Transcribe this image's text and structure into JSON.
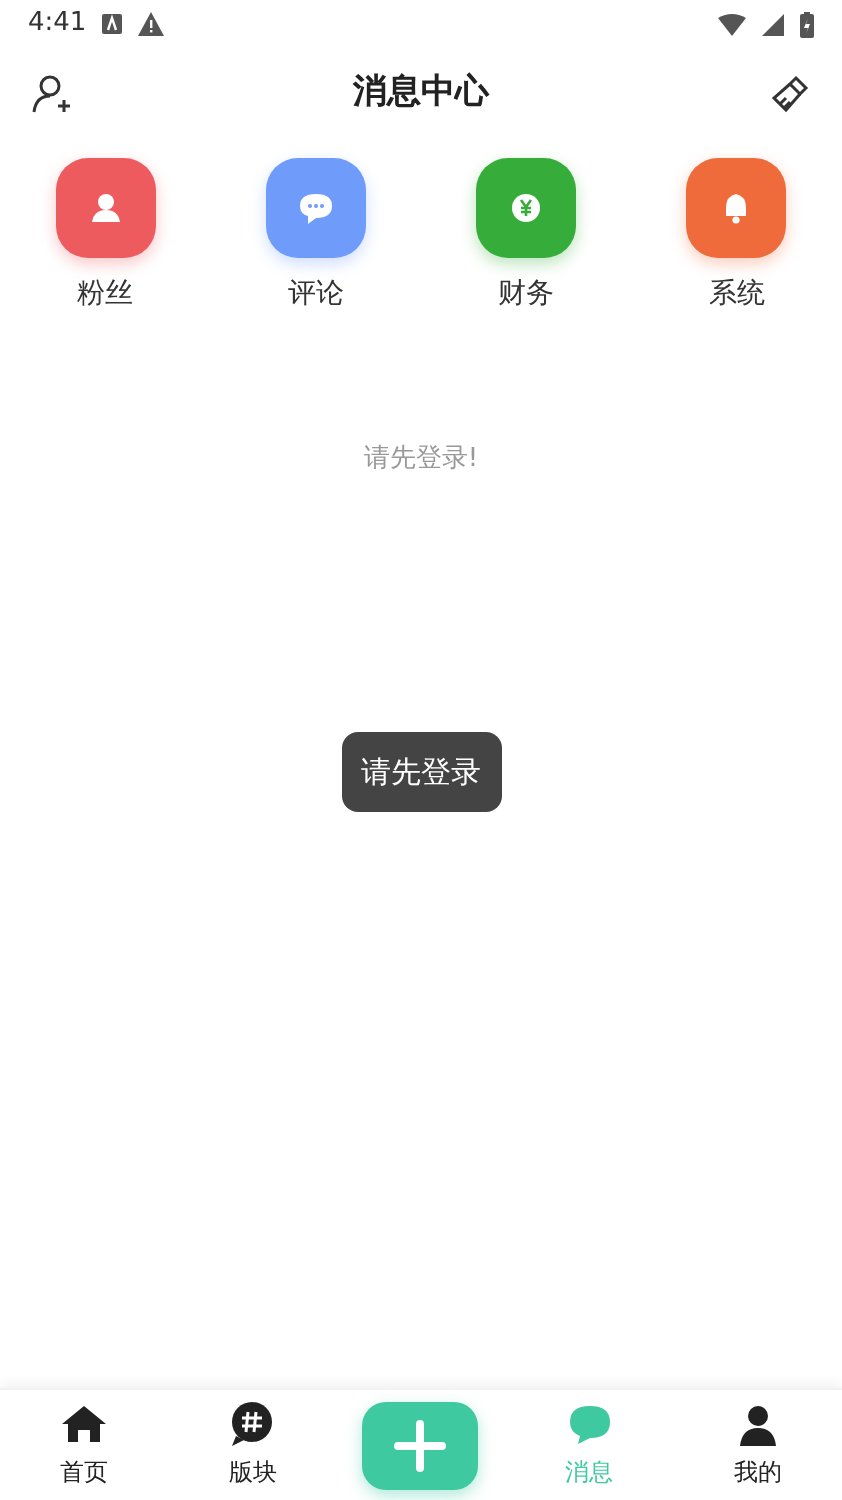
{
  "status_bar": {
    "time": "4:41"
  },
  "header": {
    "title": "消息中心"
  },
  "categories": [
    {
      "kind": "fans",
      "label": "粉丝",
      "color": "#ee5b5e"
    },
    {
      "kind": "comment",
      "label": "评论",
      "color": "#6f9cfb"
    },
    {
      "kind": "finance",
      "label": "财务",
      "color": "#36ad3a"
    },
    {
      "kind": "system",
      "label": "系统",
      "color": "#ef6b3c"
    }
  ],
  "empty_message": "请先登录!",
  "toast": "请先登录",
  "bottom_nav": [
    {
      "kind": "home",
      "label": "首页",
      "selected": false
    },
    {
      "kind": "board",
      "label": "版块",
      "selected": false
    },
    {
      "kind": "add"
    },
    {
      "kind": "message",
      "label": "消息",
      "selected": true
    },
    {
      "kind": "me",
      "label": "我的",
      "selected": false
    }
  ]
}
